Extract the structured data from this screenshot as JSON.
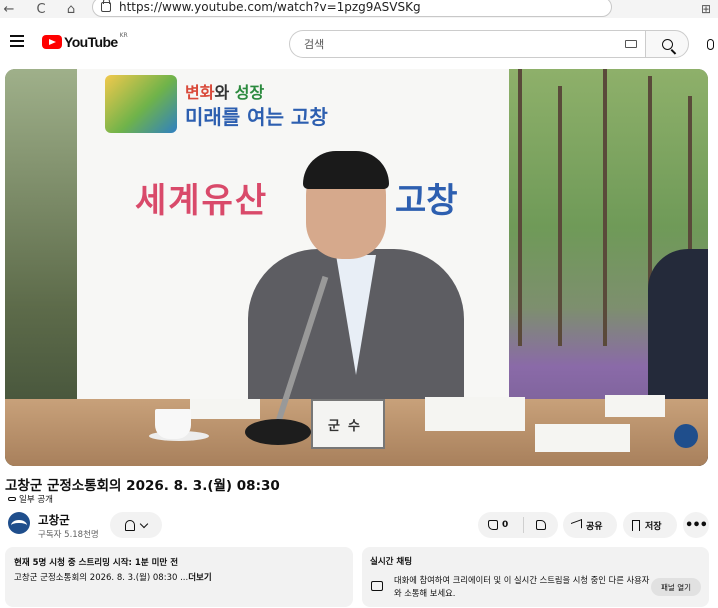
{
  "browser": {
    "url": "https://www.youtube.com/watch?v=1pzg9ASVSKg",
    "back_glyph": "←",
    "reload_glyph": "C",
    "home_glyph": "⌂",
    "ext_glyph": "⊞"
  },
  "header": {
    "logo_text": "YouTube",
    "logo_country": "KR",
    "search_placeholder": "검색"
  },
  "video": {
    "banner_line1_a": "변화",
    "banner_line1_b": "와 ",
    "banner_line1_c": "성장",
    "banner_line2": "미래를 여는 고창",
    "banner_line3": "세계유산",
    "banner_line3b": "고창",
    "nameplate": "군수"
  },
  "meta": {
    "title": "고창군 군정소통회의 2026. 8. 3.(월) 08:30",
    "visibility": "일부 공개"
  },
  "channel": {
    "name": "고창군",
    "subscribers": "구독자 5.18천명"
  },
  "actions": {
    "like_count": "0",
    "share_label": "공유",
    "save_label": "저장",
    "more_label": "•••"
  },
  "description": {
    "meta": "현재 5명 시청 중  스트리밍 시작: 1분 미만 전",
    "text": "고창군 군정소통회의 2026. 8. 3.(월) 08:30 ...",
    "more": "더보기"
  },
  "chat": {
    "title": "실시간 채팅",
    "text": "대화에 참여하여 크리에이터 및 이 실시간 스트림을 시청 중인 다른 사용자와 소통해 보세요.",
    "button": "패널 열기"
  },
  "colors": {
    "brand_red": "#ff0000",
    "pill_bg": "#f2f2f2",
    "text": "#0f0f0f"
  }
}
